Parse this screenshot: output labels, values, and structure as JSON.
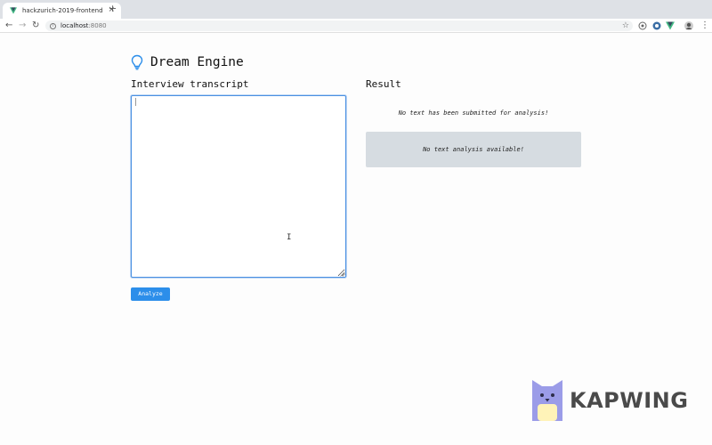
{
  "browser": {
    "tab_title": "hackzurich-2019-frontend",
    "close_glyph": "×",
    "new_tab_glyph": "+",
    "back_glyph": "←",
    "forward_glyph": "→",
    "reload_glyph": "↻",
    "url_host": "localhost",
    "url_port": ":8080",
    "star_glyph": "☆",
    "menu_glyph": "⋮",
    "icons": [
      "vue-favicon-icon",
      "info-icon",
      "star-icon",
      "extension-icon",
      "vue-devtools-icon",
      "profile-avatar-icon",
      "menu-icon"
    ]
  },
  "app": {
    "title": "Dream Engine",
    "icon": "lightbulb-icon",
    "accent": "#2c8eea"
  },
  "transcript": {
    "heading": "Interview transcript",
    "value": "",
    "button_label": "Analyze"
  },
  "result": {
    "heading": "Result",
    "no_text_message": "No text has been submitted for analysis!",
    "no_analysis_message": "No text analysis available!",
    "box_color": "#d6dce1"
  },
  "watermark": {
    "brand": "KAPWING",
    "icon": "kapwing-cat-logo"
  }
}
